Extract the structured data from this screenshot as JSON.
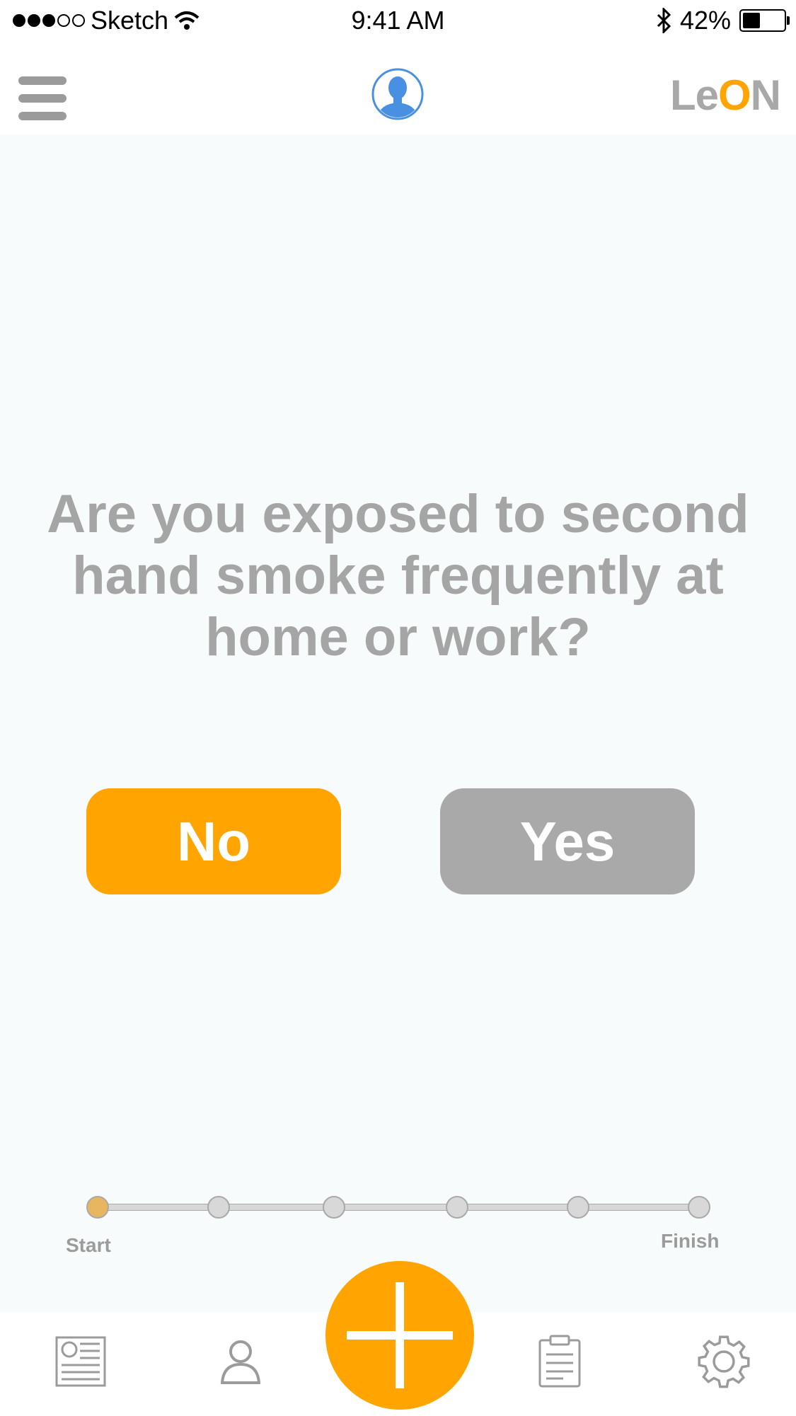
{
  "status_bar": {
    "carrier": "Sketch",
    "time": "9:41 AM",
    "battery_percent": "42%",
    "battery_level": 0.42
  },
  "header": {
    "logo_part1": "Le",
    "logo_part2": "O",
    "logo_part3": "N",
    "icons": [
      "hamburger-menu-icon",
      "user-avatar-icon"
    ]
  },
  "question": {
    "text": "Are you exposed to second hand smoke frequently at home or work?"
  },
  "answers": {
    "no_label": "No",
    "yes_label": "Yes"
  },
  "progress": {
    "start_label": "Start",
    "finish_label": "Finish",
    "total_steps": 6,
    "current_step": 1
  },
  "colors": {
    "accent": "#ffa400",
    "inactive_button": "#a9a9a9",
    "text_gray": "#a5a5a5",
    "avatar_blue": "#4a90e2"
  },
  "tab_bar": {
    "items": [
      "news-icon",
      "profile-icon",
      "add-icon",
      "clipboard-icon",
      "settings-gear-icon"
    ]
  }
}
